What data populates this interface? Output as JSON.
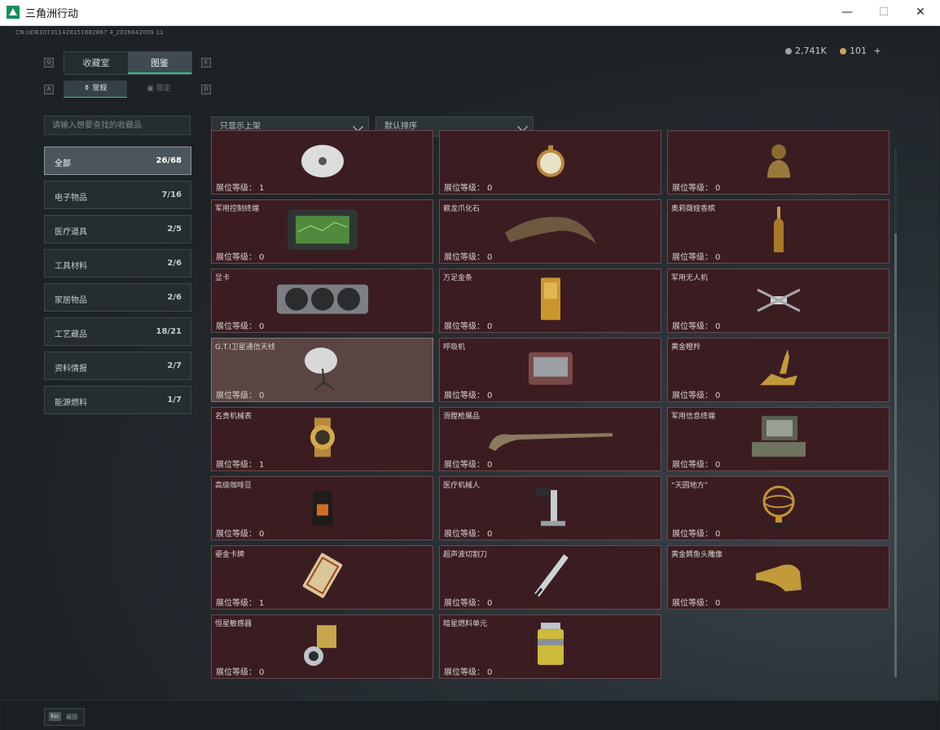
{
  "window": {
    "title": "三角洲行动",
    "minimize": "—",
    "maximize": "☐",
    "close": "✕"
  },
  "uid": "CN:UDB107311428151682867 4_2026042009 11",
  "currency": {
    "silver": "2,741K",
    "gold": "101",
    "plus": "+"
  },
  "key_hints": {
    "q": "Q",
    "e": "E",
    "a": "A",
    "d": "D"
  },
  "tabs": [
    {
      "label": "收藏室"
    },
    {
      "label": "图鉴"
    }
  ],
  "subtabs": [
    {
      "label": "常规"
    },
    {
      "label": "限定"
    }
  ],
  "search": {
    "placeholder": "请输入想要查找的收藏品"
  },
  "filters": {
    "shelf": "只显示上架",
    "sort": "默认排序"
  },
  "categories": [
    {
      "name": "全部",
      "count": "26/68"
    },
    {
      "name": "电子物品",
      "count": "7/16"
    },
    {
      "name": "医疗道具",
      "count": "2/5"
    },
    {
      "name": "工具材料",
      "count": "2/6"
    },
    {
      "name": "家居物品",
      "count": "2/6"
    },
    {
      "name": "工艺藏品",
      "count": "18/21"
    },
    {
      "name": "资料情报",
      "count": "2/7"
    },
    {
      "name": "能源燃料",
      "count": "1/7"
    }
  ],
  "level_label": "展位等级：",
  "items": [
    {
      "name": "",
      "level": "1",
      "icon": "disc-icon"
    },
    {
      "name": "",
      "level": "0",
      "icon": "pocket-watch-icon"
    },
    {
      "name": "",
      "level": "0",
      "icon": "bust-statue-icon"
    },
    {
      "name": "军用控制终端",
      "level": "0",
      "icon": "tablet-icon"
    },
    {
      "name": "赖龙爪化石",
      "level": "0",
      "icon": "claw-fossil-icon"
    },
    {
      "name": "奥莉薇娅香槟",
      "level": "0",
      "icon": "champagne-icon"
    },
    {
      "name": "显卡",
      "level": "0",
      "icon": "gpu-icon"
    },
    {
      "name": "万足金条",
      "level": "0",
      "icon": "gold-bar-icon"
    },
    {
      "name": "军用无人机",
      "level": "0",
      "icon": "drone-icon"
    },
    {
      "name": "G.T.I卫星通信天线",
      "level": "0",
      "icon": "satellite-dish-icon"
    },
    {
      "name": "呼吸机",
      "level": "0",
      "icon": "ventilator-icon"
    },
    {
      "name": "黄金瞪羚",
      "level": "0",
      "icon": "gazelle-icon"
    },
    {
      "name": "名贵机械表",
      "level": "1",
      "icon": "wristwatch-icon"
    },
    {
      "name": "滑膛枪展品",
      "level": "0",
      "icon": "musket-icon"
    },
    {
      "name": "军用信息终端",
      "level": "0",
      "icon": "rugged-laptop-icon"
    },
    {
      "name": "高级咖啡豆",
      "level": "0",
      "icon": "coffee-bag-icon"
    },
    {
      "name": "医疗机械人",
      "level": "0",
      "icon": "medical-robot-icon"
    },
    {
      "name": "“天圆地方”",
      "level": "0",
      "icon": "armillary-sphere-icon"
    },
    {
      "name": "鎏金卡牌",
      "level": "1",
      "icon": "gilded-card-icon"
    },
    {
      "name": "超声波切割刀",
      "level": "0",
      "icon": "ultrasonic-cutter-icon"
    },
    {
      "name": "黄金鳄鱼头雕像",
      "level": "0",
      "icon": "crocodile-head-icon"
    },
    {
      "name": "恒星敏感器",
      "level": "0",
      "icon": "star-sensor-icon"
    },
    {
      "name": "暗星燃料单元",
      "level": "0",
      "icon": "fuel-cell-icon"
    }
  ],
  "footer": {
    "esc_key": "Esc",
    "esc_label": "返回"
  }
}
